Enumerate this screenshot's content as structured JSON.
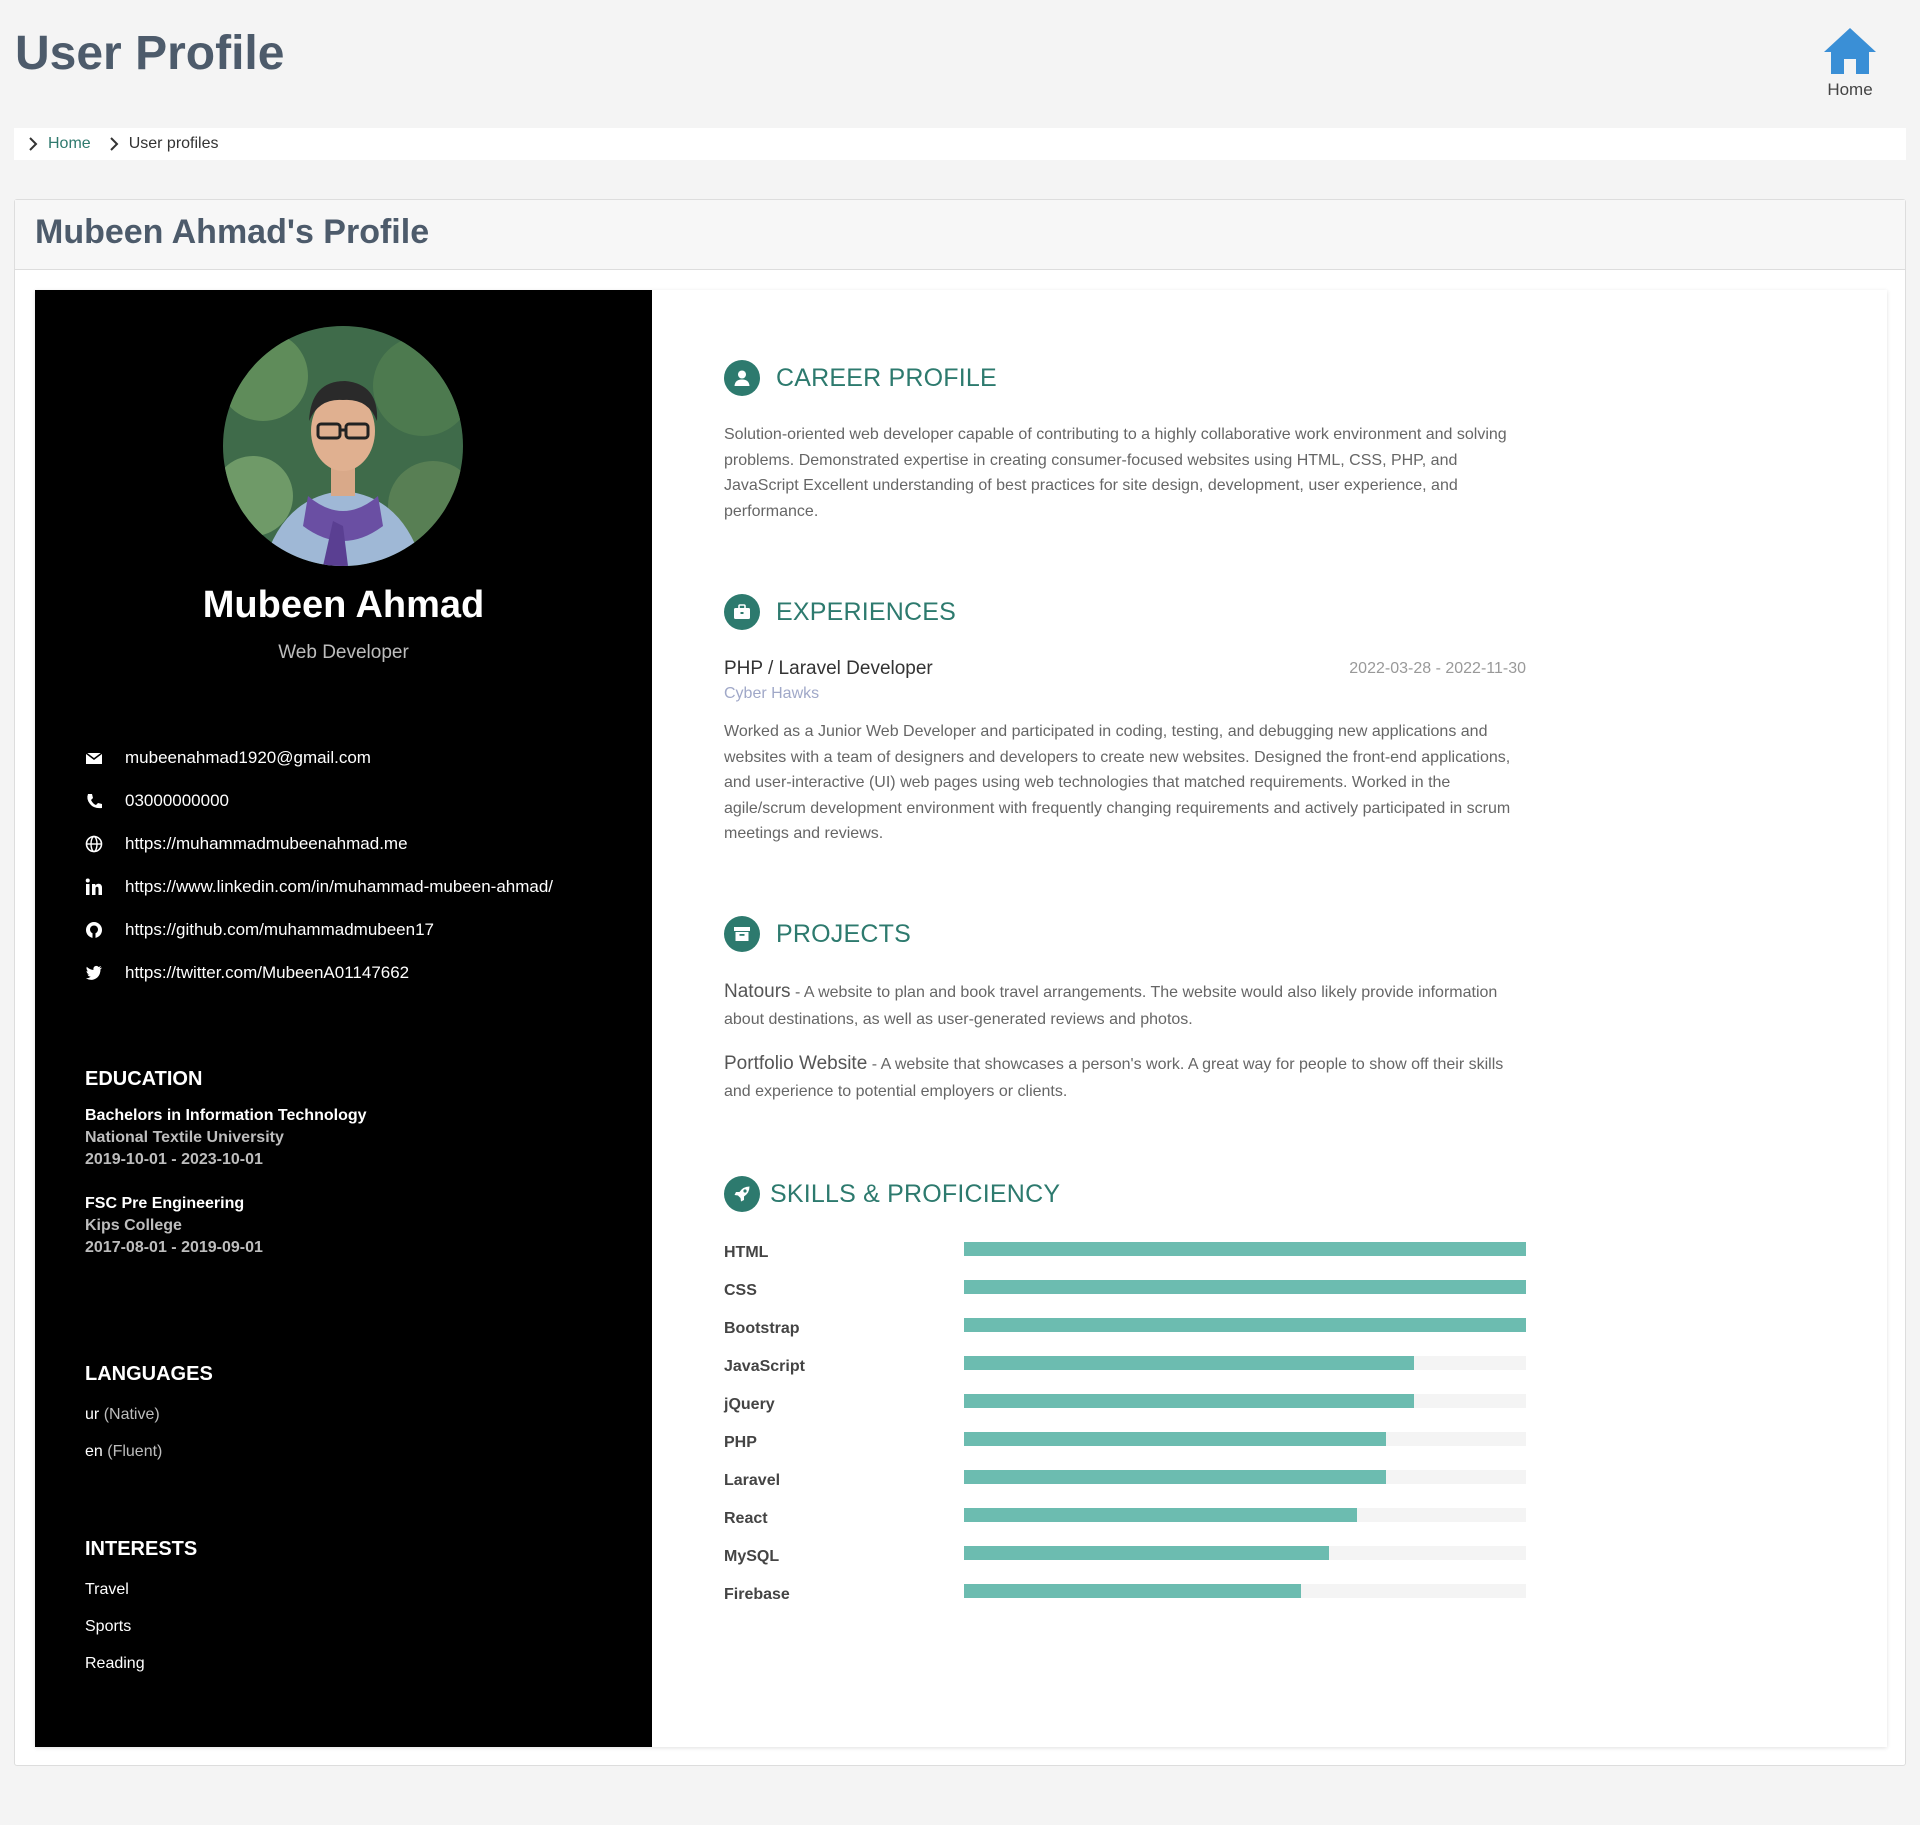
{
  "header": {
    "title": "User Profile",
    "home_label": "Home"
  },
  "breadcrumb": {
    "home": "Home",
    "current": "User profiles"
  },
  "card": {
    "title": "Mubeen Ahmad's Profile"
  },
  "profile": {
    "name": "Mubeen Ahmad",
    "tagline": "Web Developer",
    "contacts": [
      {
        "icon": "envelope-icon",
        "text": "mubeenahmad1920@gmail.com"
      },
      {
        "icon": "phone-icon",
        "text": "03000000000"
      },
      {
        "icon": "globe-icon",
        "text": "https://muhammadmubeenahmad.me"
      },
      {
        "icon": "linkedin-icon",
        "text": "https://www.linkedin.com/in/muhammad-mubeen-ahmad/"
      },
      {
        "icon": "github-icon",
        "text": "https://github.com/muhammadmubeen17"
      },
      {
        "icon": "twitter-icon",
        "text": "https://twitter.com/MubeenA01147662"
      }
    ],
    "education": {
      "heading": "EDUCATION",
      "items": [
        {
          "degree": "Bachelors in Information Technology",
          "institute": "National Textile University",
          "dates": "2019-10-01 - 2023-10-01"
        },
        {
          "degree": "FSC Pre Engineering",
          "institute": "Kips College",
          "dates": "2017-08-01 - 2019-09-01"
        }
      ]
    },
    "languages": {
      "heading": "LANGUAGES",
      "items": [
        {
          "lang": "ur",
          "level": "(Native)"
        },
        {
          "lang": "en",
          "level": "(Fluent)"
        }
      ]
    },
    "interests": {
      "heading": "INTERESTS",
      "items": [
        "Travel",
        "Sports",
        "Reading"
      ]
    }
  },
  "career": {
    "heading": "CAREER PROFILE",
    "text": "Solution-oriented web developer capable of contributing to a highly collaborative work environment and solving problems. Demonstrated expertise in creating consumer-focused websites using HTML, CSS, PHP, and JavaScript Excellent understanding of best practices for site design, development, user experience, and performance."
  },
  "experiences": {
    "heading": "EXPERIENCES",
    "items": [
      {
        "title": "PHP / Laravel Developer",
        "dates": "2022-03-28 - 2022-11-30",
        "company": "Cyber Hawks",
        "description": "Worked as a Junior Web Developer and participated in coding, testing, and debugging new applications and websites with a team of designers and developers to create new websites. Designed the front-end applications, and user-interactive (UI) web pages using web technologies that matched requirements. Worked in the agile/scrum development environment with frequently changing requirements and actively participated in scrum meetings and reviews."
      }
    ]
  },
  "projects": {
    "heading": "PROJECTS",
    "items": [
      {
        "name": "Natours",
        "description": " - A website to plan and book travel arrangements. The website would also likely provide information about destinations, as well as user-generated reviews and photos."
      },
      {
        "name": "Portfolio Website",
        "description": " - A website that showcases a person's work. A great way for people to show off their skills and experience to potential employers or clients."
      }
    ]
  },
  "skills": {
    "heading": "SKILLS & PROFICIENCY",
    "items": [
      {
        "name": "HTML",
        "level": 100
      },
      {
        "name": "CSS",
        "level": 100
      },
      {
        "name": "Bootstrap",
        "level": 100
      },
      {
        "name": "JavaScript",
        "level": 80
      },
      {
        "name": "jQuery",
        "level": 80
      },
      {
        "name": "PHP",
        "level": 75
      },
      {
        "name": "Laravel",
        "level": 75
      },
      {
        "name": "React",
        "level": 70
      },
      {
        "name": "MySQL",
        "level": 65
      },
      {
        "name": "Firebase",
        "level": 60
      }
    ]
  },
  "colors": {
    "accent": "#2d7a6e",
    "skill_bar": "#6cbcb0",
    "home_icon": "#3a8fd6",
    "sidebar": "#000000"
  }
}
